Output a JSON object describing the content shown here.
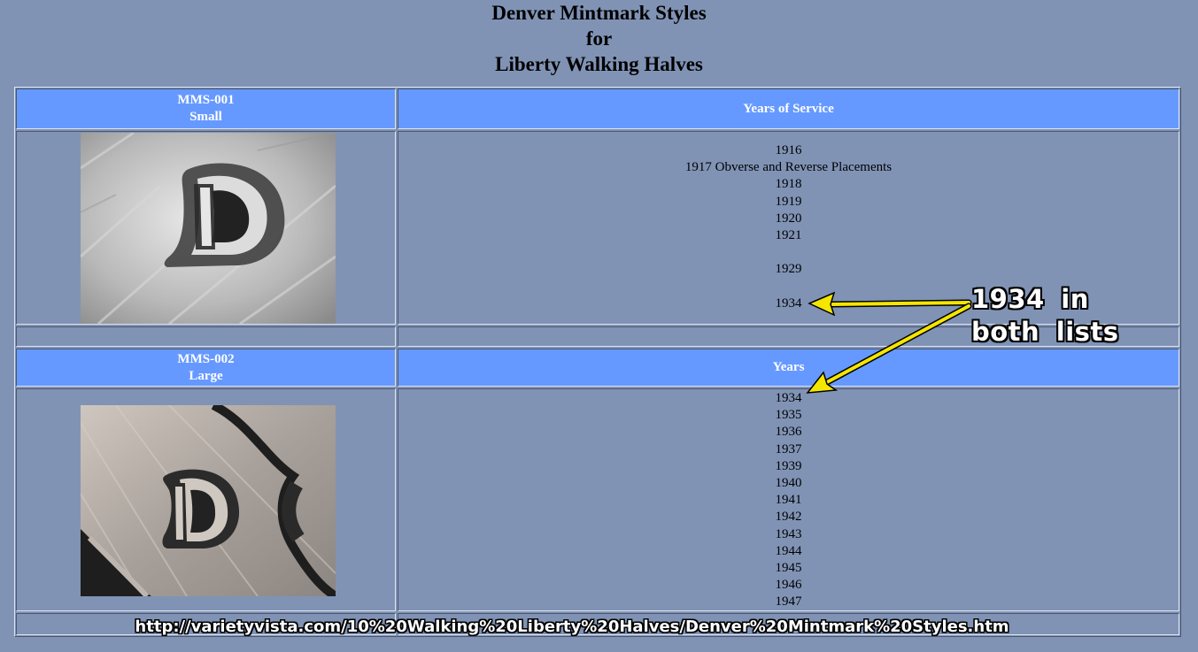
{
  "page": {
    "title_lines": [
      "Denver Mintmark Styles",
      "for",
      "Liberty Walking Halves"
    ]
  },
  "table": {
    "section_1": {
      "style_code": "MMS-001",
      "style_name": "Small",
      "years_header": "Years of Service",
      "years_group_a": [
        "1916",
        "1917 Obverse and Reverse Placements",
        "1918",
        "1919",
        "1920",
        "1921"
      ],
      "years_group_b": [
        "1929"
      ],
      "years_group_c": [
        "1934"
      ],
      "photo_icon": "coin-d-mintmark-small"
    },
    "section_2": {
      "style_code": "MMS-002",
      "style_name": "Large",
      "years_header": "Years",
      "years": [
        "1934",
        "1935",
        "1936",
        "1937",
        "1939",
        "1940",
        "1941",
        "1942",
        "1943",
        "1944",
        "1945",
        "1946",
        "1947"
      ],
      "photo_icon": "coin-d-mintmark-large"
    }
  },
  "annotation": {
    "lines": [
      "1934  in",
      "both  lists"
    ],
    "arrow_color": "#f5e600"
  },
  "caption": {
    "url": "http://varietyvista.com/10%20Walking%20Liberty%20Halves/Denver%20Mintmark%20Styles.htm"
  },
  "colors": {
    "background": "#8093b5",
    "header": "#6699ff"
  }
}
